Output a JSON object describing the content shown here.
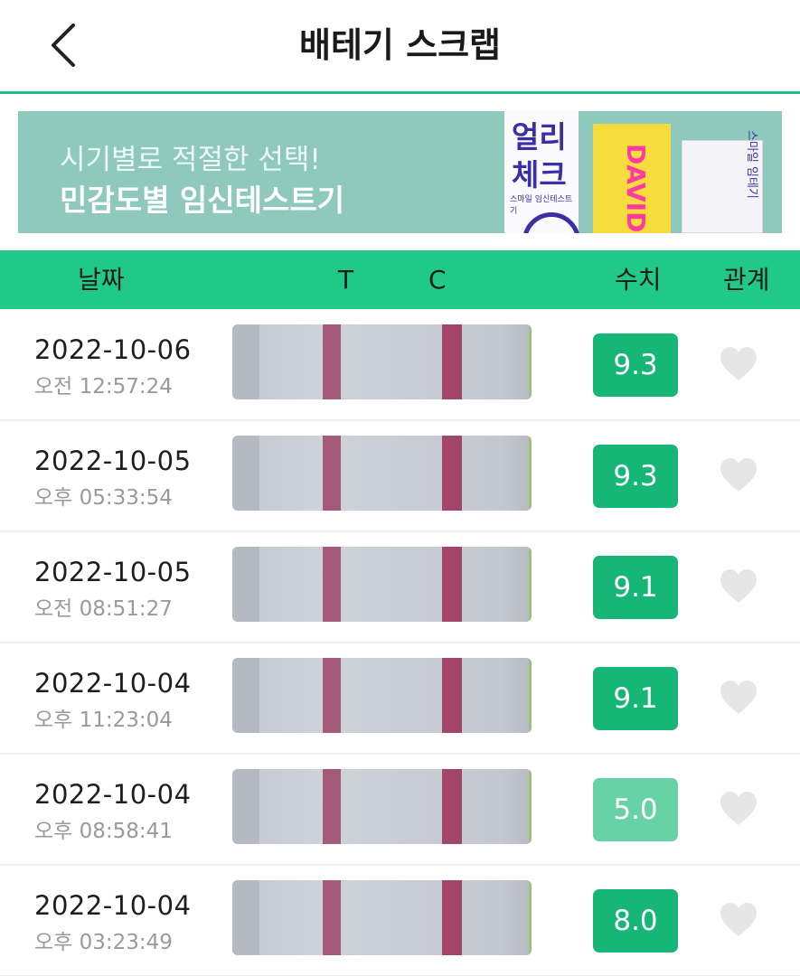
{
  "header": {
    "title": "배테기 스크랩",
    "back_icon": "chevron-left-icon"
  },
  "banner": {
    "subtitle": "시기별로 적절한 선택!",
    "headline": "민감도별 임신테스트기",
    "pkg_a_title": "얼리\n체크",
    "pkg_a_caption": "스마일 임신테스트기",
    "pkg_b_title": "DAVID -SUPE",
    "pkg_c_title": "스마일 임테기"
  },
  "columns": {
    "date": "날짜",
    "t": "T",
    "c": "C",
    "value": "수치",
    "relation": "관계"
  },
  "colors": {
    "accent": "#20c988",
    "value_strong": "#16b676",
    "value_light": "#66d2a6",
    "heart": "#e6e6e6"
  },
  "rows": [
    {
      "date": "2022-10-06",
      "time": "오전 12:57:24",
      "value": "9.3",
      "strength": "strong",
      "liked": false
    },
    {
      "date": "2022-10-05",
      "time": "오후 05:33:54",
      "value": "9.3",
      "strength": "strong",
      "liked": false
    },
    {
      "date": "2022-10-05",
      "time": "오전 08:51:27",
      "value": "9.1",
      "strength": "strong",
      "liked": false
    },
    {
      "date": "2022-10-04",
      "time": "오후 11:23:04",
      "value": "9.1",
      "strength": "strong",
      "liked": false
    },
    {
      "date": "2022-10-04",
      "time": "오후 08:58:41",
      "value": "5.0",
      "strength": "light",
      "liked": false
    },
    {
      "date": "2022-10-04",
      "time": "오후 03:23:49",
      "value": "8.0",
      "strength": "strong",
      "liked": false
    }
  ]
}
